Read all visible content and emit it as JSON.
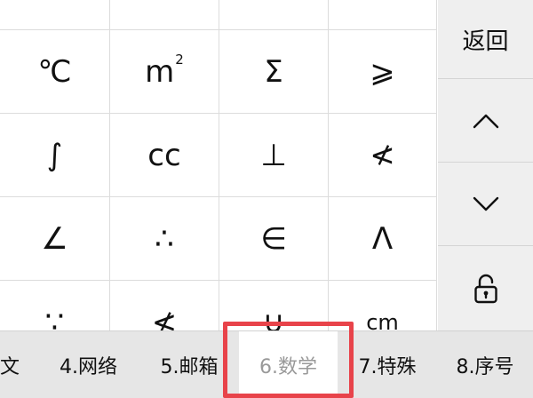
{
  "symbols": [
    [
      "",
      "",
      "",
      ""
    ],
    [
      "℃",
      "m",
      "Σ",
      "⩾"
    ],
    [
      "∫",
      "cc",
      "⊥",
      "≮"
    ],
    [
      "∠",
      "∴",
      "∈",
      "Λ"
    ],
    [
      "∵",
      "≮",
      "∪",
      "cm"
    ]
  ],
  "m2_superscript": "2",
  "sidebar": {
    "back_label": "返回",
    "up_icon": "chevron-up-icon",
    "down_icon": "chevron-down-icon",
    "lock_icon": "unlock-icon"
  },
  "categories": [
    {
      "label": "文"
    },
    {
      "label": "4.网络"
    },
    {
      "label": "5.邮箱"
    },
    {
      "label": "6.数学",
      "selected": true
    },
    {
      "label": "7.特殊"
    },
    {
      "label": "8.序号"
    }
  ],
  "colors": {
    "highlight": "#e8434a",
    "selected_text": "#999999",
    "sidebar_bg": "#efefef",
    "category_bg": "#e6e6e6"
  }
}
